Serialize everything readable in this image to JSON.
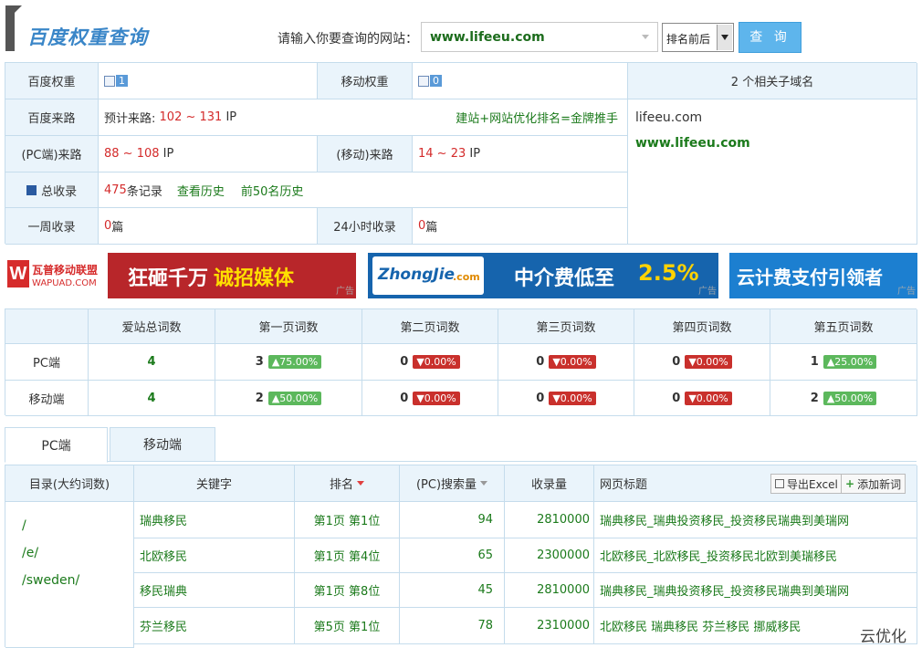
{
  "header": {
    "logo": "百度权重查询",
    "search_label": "请输入你要查询的网站：",
    "search_value": "www.lifeeu.com",
    "rank_select": "排名前后",
    "query_button": "查 询"
  },
  "summary": {
    "baidu_weight_label": "百度权重",
    "baidu_weight_value": "1",
    "mobile_weight_label": "移动权重",
    "mobile_weight_value": "0",
    "subdomain_header": "2 个相关子域名",
    "subdomains": [
      "lifeeu.com",
      "www.lifeeu.com"
    ],
    "source_label": "百度来路",
    "source_prefix": "预计来路:",
    "source_range": "102 ~ 131",
    "ip_unit": "IP",
    "promo": "建站+网站优化排名=金牌推手",
    "pc_label": "(PC端)来路",
    "pc_range": "88 ~ 108",
    "mobile_source_label": "(移动)来路",
    "mobile_range": "14 ~ 23",
    "index_label": "总收录",
    "index_count": "475",
    "index_unit": "条记录",
    "history_link": "查看历史",
    "top50_link": "前50名历史",
    "week_label": "一周收录",
    "week_value": "0",
    "day_label": "24小时收录",
    "day_value": "0",
    "piece_unit": "篇"
  },
  "ads": {
    "ad1_brand": "瓦普移动联盟",
    "ad1_brand_sub": "WAPUAD.COM",
    "ad1_text": "狂砸千万",
    "ad1_text2": "诚招媒体",
    "ad2_brand": "ZhongJie",
    "ad2_brand_sub": ".com",
    "ad2_text": "中介费低至",
    "ad2_pct": "2.5%",
    "ad3_text": "云计费支付引领者",
    "ad_label": "广告"
  },
  "ranking": {
    "headers": [
      "",
      "爱站总词数",
      "第一页词数",
      "第二页词数",
      "第三页词数",
      "第四页词数",
      "第五页词数"
    ],
    "rows": [
      {
        "label": "PC端",
        "total": "4",
        "cells": [
          {
            "n": "3",
            "pct": "▲75.00%",
            "dir": "up"
          },
          {
            "n": "0",
            "pct": "▼0.00%",
            "dir": "down"
          },
          {
            "n": "0",
            "pct": "▼0.00%",
            "dir": "down"
          },
          {
            "n": "0",
            "pct": "▼0.00%",
            "dir": "down"
          },
          {
            "n": "1",
            "pct": "▲25.00%",
            "dir": "up"
          }
        ]
      },
      {
        "label": "移动端",
        "total": "4",
        "cells": [
          {
            "n": "2",
            "pct": "▲50.00%",
            "dir": "up"
          },
          {
            "n": "0",
            "pct": "▼0.00%",
            "dir": "down"
          },
          {
            "n": "0",
            "pct": "▼0.00%",
            "dir": "down"
          },
          {
            "n": "0",
            "pct": "▼0.00%",
            "dir": "down"
          },
          {
            "n": "2",
            "pct": "▲50.00%",
            "dir": "up"
          }
        ]
      }
    ]
  },
  "tabs": [
    "PC端",
    "移动端"
  ],
  "keywords": {
    "headers": [
      "目录(大约词数)",
      "关键字",
      "排名",
      "(PC)搜索量",
      "收录量",
      "网页标题"
    ],
    "export_button": "导出Excel",
    "add_button": "添加新词",
    "directories": [
      "/",
      "/e/",
      "/sweden/"
    ],
    "rows": [
      {
        "keyword": "瑞典移民",
        "rank": "第1页 第1位",
        "volume": "94",
        "indexed": "2810000",
        "title": "瑞典移民_瑞典投资移民_投资移民瑞典到美瑞网"
      },
      {
        "keyword": "北欧移民",
        "rank": "第1页 第4位",
        "volume": "65",
        "indexed": "2300000",
        "title": "北欧移民_北欧移民_投资移民北欧到美瑞移民"
      },
      {
        "keyword": "移民瑞典",
        "rank": "第1页 第8位",
        "volume": "45",
        "indexed": "2810000",
        "title": "瑞典移民_瑞典投资移民_投资移民瑞典到美瑞网"
      },
      {
        "keyword": "芬兰移民",
        "rank": "第5页 第1位",
        "volume": "78",
        "indexed": "2310000",
        "title": "北欧移民 瑞典移民 芬兰移民 挪威移民"
      }
    ]
  },
  "watermark": "云优化",
  "colors": {
    "accent": "#3a86c8",
    "header_bg": "#eaf4fb",
    "border": "#c5dcec",
    "up": "#5cb85c",
    "down": "#c9302c",
    "link_green": "#1b7a1b",
    "red": "#d42b2b"
  }
}
